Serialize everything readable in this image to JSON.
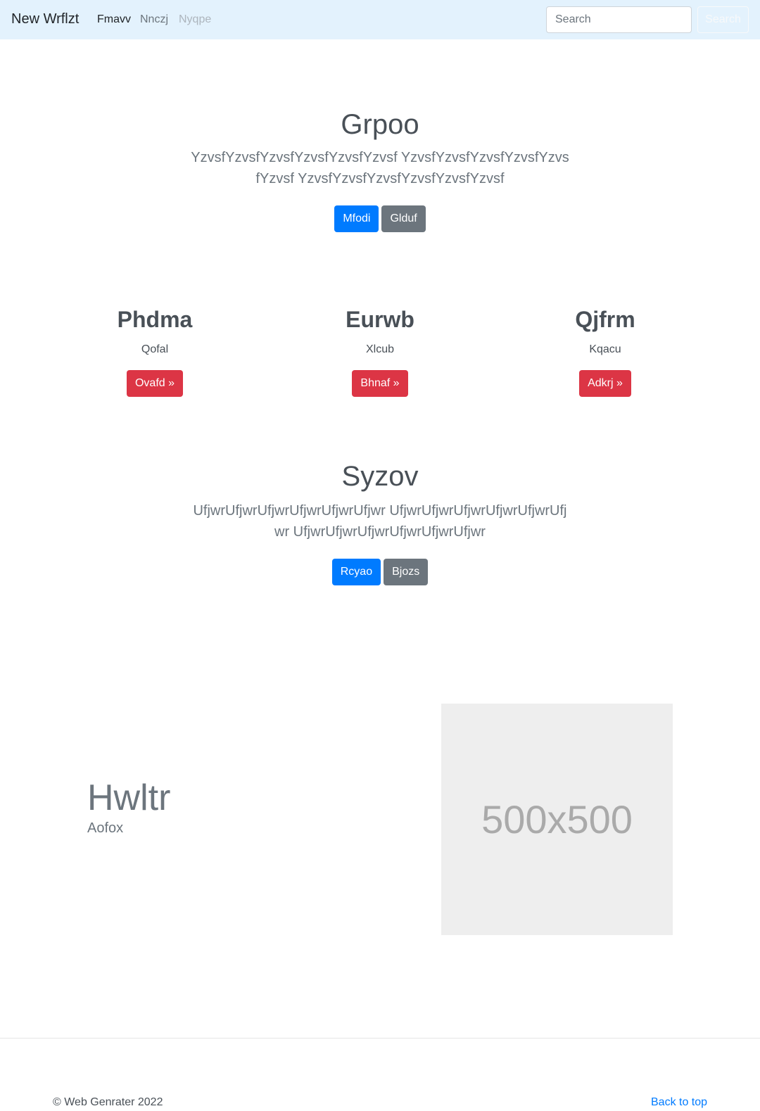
{
  "navbar": {
    "brand": "New Wrflzt",
    "links": [
      "Fmavv",
      "Nnczj",
      "Nyqpe"
    ],
    "search_placeholder": "Search",
    "search_button": "Search"
  },
  "hero1": {
    "title": "Grpoo",
    "lead": "YzvsfYzvsfYzvsfYzvsfYzvsfYzvsf YzvsfYzvsfYzvsfYzvsfYzvsfYzvsf YzvsfYzvsfYzvsfYzvsfYzvsfYzvsf",
    "primary_button": "Mfodi",
    "secondary_button": "Glduf"
  },
  "columns": [
    {
      "title": "Phdma",
      "text": "Qofal",
      "button": "Ovafd »"
    },
    {
      "title": "Eurwb",
      "text": "Xlcub",
      "button": "Bhnaf »"
    },
    {
      "title": "Qjfrm",
      "text": "Kqacu",
      "button": "Adkrj »"
    }
  ],
  "hero2": {
    "title": "Syzov",
    "lead": "UfjwrUfjwrUfjwrUfjwrUfjwrUfjwr UfjwrUfjwrUfjwrUfjwrUfjwrUfjwr UfjwrUfjwrUfjwrUfjwrUfjwrUfjwr",
    "primary_button": "Rcyao",
    "secondary_button": "Bjozs"
  },
  "feature": {
    "title": "Hwltr",
    "subtitle": "Aofox",
    "image_label": "500x500"
  },
  "footer": {
    "copyright": "© Web Genrater 2022",
    "back_to_top": "Back to top"
  }
}
